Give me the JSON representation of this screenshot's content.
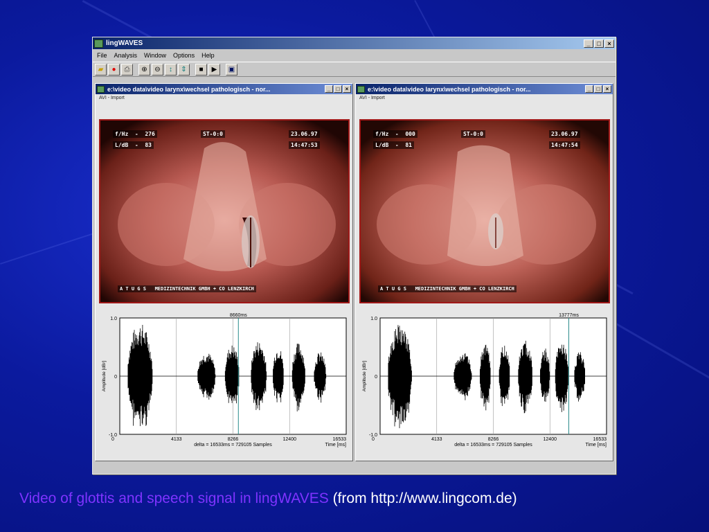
{
  "window": {
    "title": "lingWAVES",
    "controls": [
      "_",
      "□",
      "×"
    ]
  },
  "menu": [
    "File",
    "Analysis",
    "Window",
    "Options",
    "Help"
  ],
  "toolbar": {
    "icons": [
      "open-icon",
      "record-icon",
      "print-icon",
      "zoom-in-icon",
      "zoom-out-icon",
      "fit-icon",
      "scroll-icon",
      "stop-icon",
      "play-icon",
      "save-icon"
    ]
  },
  "children": [
    {
      "title": "e:\\video data\\video larynx\\wechsel pathologisch - nor...",
      "subtitle": "AVI - Import",
      "osd": {
        "f0": "f/Hz  -  276",
        "level": "L/dB  -  83",
        "st": "ST-0:0",
        "date": "23.06.97",
        "time": "14:47:53",
        "footer": "A T U G S   MEDIZINTECHNIK GMBH + CO LENZKIRCH"
      },
      "plot": {
        "marker_label": "8660ms",
        "y_ticks": [
          "1.0",
          "0",
          "-1.0"
        ],
        "x_ticks": [
          "0",
          "4133",
          "8266",
          "12400",
          "16533"
        ],
        "y_axis_label": "Amplitude [dBr]",
        "x_axis_label": "Time [ms]",
        "delta_label": "delta = 16533ms = 729105 Samples",
        "marker_ms": 8660
      }
    },
    {
      "title": "e:\\video data\\video larynx\\wechsel pathologisch - nor...",
      "subtitle": "AVI - Import",
      "osd": {
        "f0": "f/Hz  -  000",
        "level": "L/dB  -  81",
        "st": "ST-0:0",
        "date": "23.06.97",
        "time": "14:47:54",
        "footer": "A T U G S   MEDIZINTECHNIK GMBH + CO LENZKIRCH"
      },
      "plot": {
        "marker_label": "13777ms",
        "y_ticks": [
          "1.0",
          "0",
          "-1.0"
        ],
        "x_ticks": [
          "0",
          "4133",
          "8266",
          "12400",
          "16533"
        ],
        "y_axis_label": "Amplitude [dBr]",
        "x_axis_label": "Time [ms]",
        "delta_label": "delta = 16533ms = 729105 Samples",
        "marker_ms": 13777
      }
    }
  ],
  "caption": {
    "main": "Video of glottis and speech signal in lingWAVES",
    "source": "(from http://www.lingcom.de)"
  },
  "colors": {
    "background": "#0b1a9e",
    "caption_main": "#7f33ff",
    "caption_source": "#ffffff",
    "video_border": "#a01818",
    "marker_line": "#2a8a8a"
  }
}
